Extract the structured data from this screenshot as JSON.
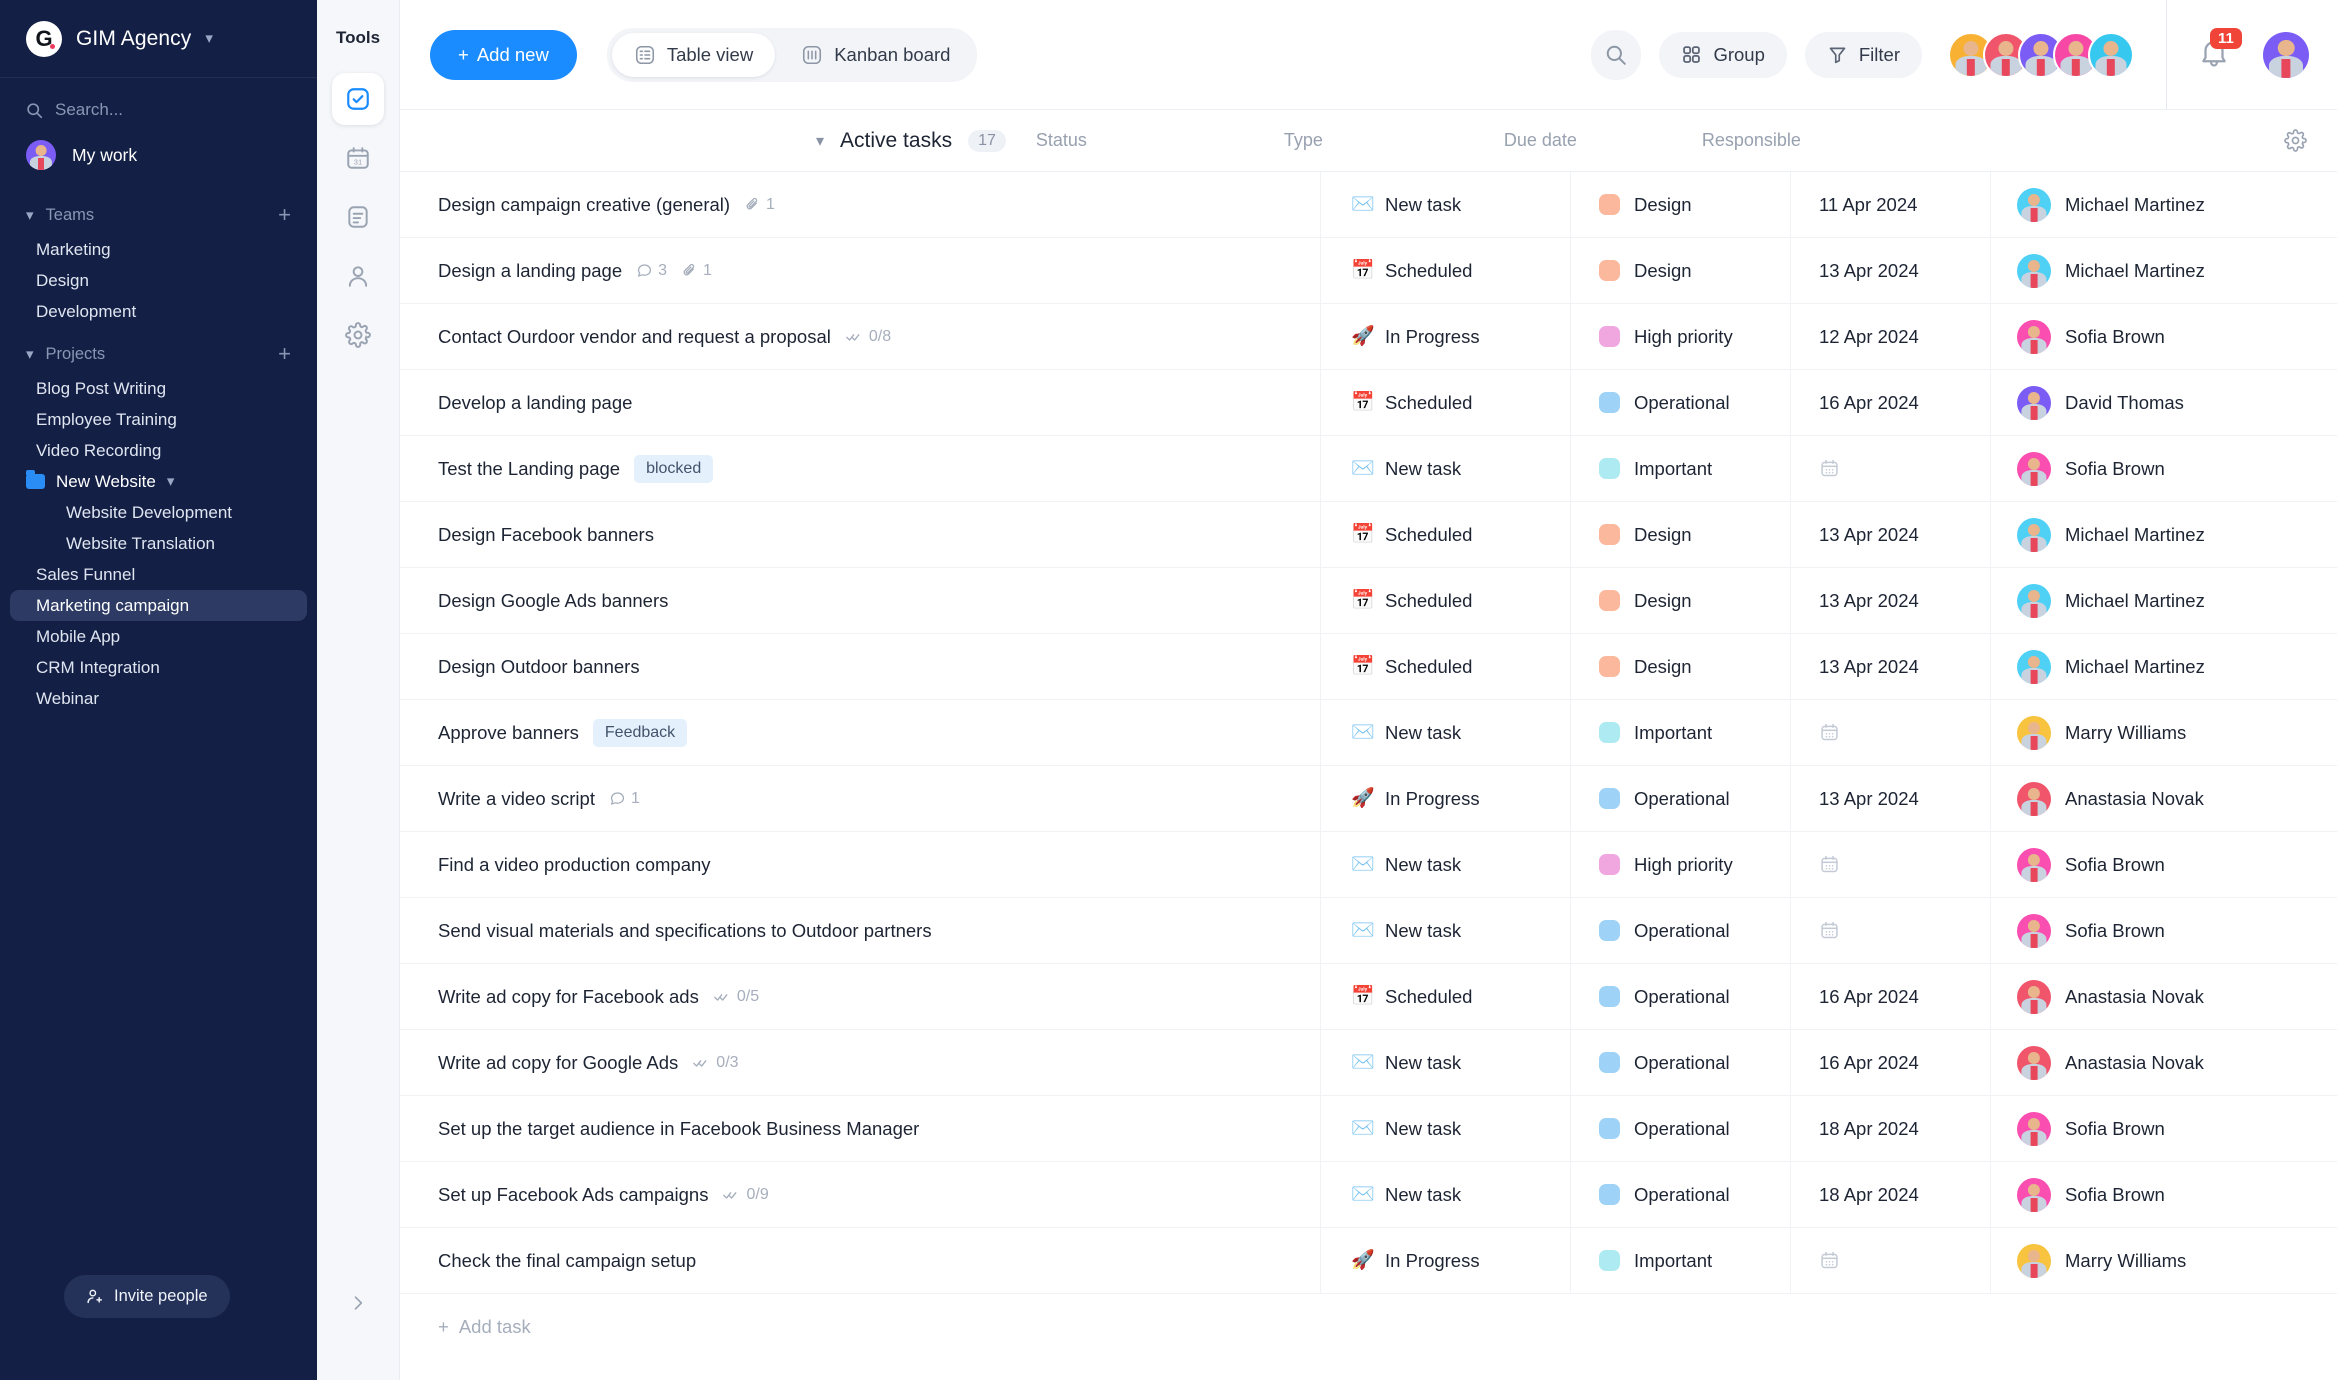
{
  "sidebar": {
    "brand": {
      "name": "GIM Agency",
      "logo_letter": "G",
      "chevron_icon": "chevron-down-icon"
    },
    "search": {
      "placeholder": "Search...",
      "icon": "search-icon"
    },
    "my_work": {
      "label": "My work"
    },
    "teams": {
      "label": "Teams",
      "add_icon": "plus-icon",
      "items": [
        "Marketing",
        "Design",
        "Development"
      ]
    },
    "projects": {
      "label": "Projects",
      "add_icon": "plus-icon",
      "items": [
        {
          "label": "Blog Post Writing",
          "type": "project"
        },
        {
          "label": "Employee Training",
          "type": "project"
        },
        {
          "label": "Video Recording",
          "type": "project"
        },
        {
          "label": "New Website",
          "type": "folder"
        },
        {
          "label": "Website Development",
          "type": "sub"
        },
        {
          "label": "Website Translation",
          "type": "sub"
        },
        {
          "label": "Sales Funnel",
          "type": "project"
        },
        {
          "label": "Marketing campaign",
          "type": "project",
          "active": true
        },
        {
          "label": "Mobile App",
          "type": "project"
        },
        {
          "label": "CRM Integration",
          "type": "project"
        },
        {
          "label": "Webinar",
          "type": "project"
        }
      ]
    },
    "invite": {
      "label": "Invite people",
      "icon": "user-plus-icon"
    }
  },
  "rail": {
    "title": "Tools",
    "items": [
      {
        "name": "tasks-icon",
        "active": true
      },
      {
        "name": "calendar-icon",
        "active": false
      },
      {
        "name": "notes-icon",
        "active": false
      },
      {
        "name": "contacts-icon",
        "active": false
      },
      {
        "name": "settings-icon",
        "active": false
      }
    ],
    "collapse_icon": "chevron-right-icon"
  },
  "toolbar": {
    "add_new_label": "Add new",
    "views": [
      {
        "label": "Table view",
        "icon": "table-icon",
        "active": true
      },
      {
        "label": "Kanban board",
        "icon": "kanban-icon",
        "active": false
      }
    ],
    "search_icon": "search-icon",
    "group_label": "Group",
    "group_icon": "grid-icon",
    "filter_label": "Filter",
    "filter_icon": "funnel-icon",
    "member_avatars": [
      "#f8b133",
      "#f0556b",
      "#7b5cf5",
      "#f748a5",
      "#37c8f0"
    ],
    "notifications": {
      "icon": "bell-icon",
      "count": "11",
      "badge_color": "#f04438"
    },
    "user_avatar_color": "#7b5cf5",
    "accent_color": "#1a8cff"
  },
  "table": {
    "group": {
      "label": "Active tasks",
      "count": "17",
      "collapse_icon": "chevron-down-icon"
    },
    "columns": [
      "Status",
      "Type",
      "Due date",
      "Responsible"
    ],
    "settings_icon": "gear-icon",
    "add_task_label": "Add task",
    "type_colors": {
      "Design": "#fbb89c",
      "High priority": "#f0a6de",
      "Operational": "#9ed3f7",
      "Important": "#aeeaf2"
    },
    "avatar_colors": {
      "Michael Martinez": "#4fd0f5",
      "Sofia Brown": "#fa4eb0",
      "David Thomas": "#7b5cf5",
      "Marry Williams": "#f8c33f",
      "Anastasia Novak": "#f0556b"
    },
    "status_icons": {
      "New task": "✉️",
      "Scheduled": "📅",
      "In Progress": "🚀"
    },
    "empty_due_icon": "calendar-outline-icon",
    "rows": [
      {
        "task": "Design campaign creative (general)",
        "attachments": "1",
        "status": "New task",
        "type": "Design",
        "due": "11 Apr 2024",
        "responsible": "Michael Martinez"
      },
      {
        "task": "Design a landing page",
        "comments": "3",
        "attachments": "1",
        "status": "Scheduled",
        "type": "Design",
        "due": "13 Apr 2024",
        "responsible": "Michael Martinez"
      },
      {
        "task": "Contact Ourdoor vendor and request a proposal",
        "subtasks": "0/8",
        "status": "In Progress",
        "type": "High priority",
        "due": "12 Apr 2024",
        "responsible": "Sofia Brown"
      },
      {
        "task": "Develop a landing page",
        "status": "Scheduled",
        "type": "Operational",
        "due": "16 Apr 2024",
        "responsible": "David Thomas"
      },
      {
        "task": "Test the Landing page",
        "badge": "blocked",
        "status": "New task",
        "type": "Important",
        "due": "",
        "responsible": "Sofia Brown"
      },
      {
        "task": "Design Facebook banners",
        "status": "Scheduled",
        "type": "Design",
        "due": "13 Apr 2024",
        "responsible": "Michael Martinez"
      },
      {
        "task": "Design Google Ads banners",
        "status": "Scheduled",
        "type": "Design",
        "due": "13 Apr 2024",
        "responsible": "Michael Martinez"
      },
      {
        "task": "Design Outdoor banners",
        "status": "Scheduled",
        "type": "Design",
        "due": "13 Apr 2024",
        "responsible": "Michael Martinez"
      },
      {
        "task": "Approve banners",
        "badge": "Feedback",
        "status": "New task",
        "type": "Important",
        "due": "",
        "responsible": "Marry Williams"
      },
      {
        "task": "Write a video script",
        "comments": "1",
        "status": "In Progress",
        "type": "Operational",
        "due": "13 Apr 2024",
        "responsible": "Anastasia Novak"
      },
      {
        "task": "Find a video production company",
        "status": "New task",
        "type": "High priority",
        "due": "",
        "responsible": "Sofia Brown"
      },
      {
        "task": "Send visual materials and specifications to Outdoor partners",
        "status": "New task",
        "type": "Operational",
        "due": "",
        "responsible": "Sofia Brown"
      },
      {
        "task": "Write ad copy for Facebook ads",
        "subtasks": "0/5",
        "status": "Scheduled",
        "type": "Operational",
        "due": "16 Apr 2024",
        "responsible": "Anastasia Novak"
      },
      {
        "task": "Write ad copy for Google Ads",
        "subtasks": "0/3",
        "status": "New task",
        "type": "Operational",
        "due": "16 Apr 2024",
        "responsible": "Anastasia Novak"
      },
      {
        "task": "Set up the target audience in Facebook Business Manager",
        "status": "New task",
        "type": "Operational",
        "due": "18 Apr 2024",
        "responsible": "Sofia Brown"
      },
      {
        "task": "Set up Facebook Ads campaigns",
        "subtasks": "0/9",
        "status": "New task",
        "type": "Operational",
        "due": "18 Apr 2024",
        "responsible": "Sofia Brown"
      },
      {
        "task": "Check the final campaign setup",
        "status": "In Progress",
        "type": "Important",
        "due": "",
        "responsible": "Marry Williams"
      }
    ]
  }
}
